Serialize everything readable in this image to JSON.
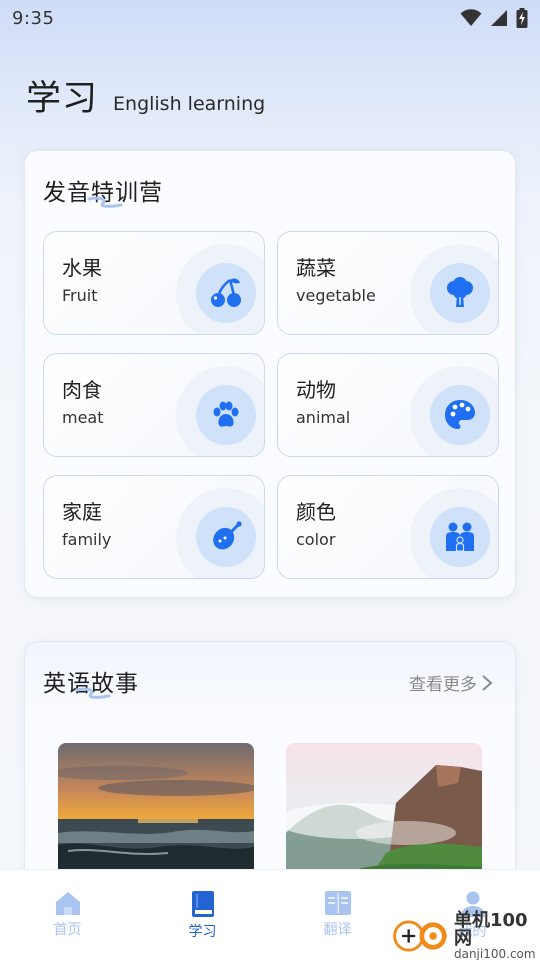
{
  "status_bar": {
    "time": "9:35"
  },
  "header": {
    "title": "学习",
    "subtitle": "English learning"
  },
  "pronunciation_camp": {
    "title": "发音特训营",
    "items": [
      {
        "zh": "水果",
        "en": "Fruit",
        "icon": "cherries-icon"
      },
      {
        "zh": "蔬菜",
        "en": "vegetable",
        "icon": "broccoli-icon"
      },
      {
        "zh": "肉食",
        "en": "meat",
        "icon": "paw-icon"
      },
      {
        "zh": "动物",
        "en": "animal",
        "icon": "palette-icon"
      },
      {
        "zh": "家庭",
        "en": "family",
        "icon": "drumstick-icon"
      },
      {
        "zh": "颜色",
        "en": "color",
        "icon": "people-icon"
      }
    ]
  },
  "stories": {
    "title": "英语故事",
    "more_label": "查看更多",
    "thumbnails": [
      "sunset-sea-image",
      "misty-cliff-image"
    ]
  },
  "bottom_nav": {
    "items": [
      {
        "label": "首页",
        "icon": "home-icon",
        "active": false
      },
      {
        "label": "学习",
        "icon": "book-icon",
        "active": true
      },
      {
        "label": "翻译",
        "icon": "translate-book-icon",
        "active": false
      },
      {
        "label": "我的",
        "icon": "user-icon",
        "active": false
      }
    ]
  },
  "watermark": {
    "name": "单机100网",
    "url": "danji100.com"
  },
  "colors": {
    "accent": "#2364d2",
    "icon_blue": "#1f6ff0",
    "icon_bg": "#cfe2fa",
    "nav_inactive": "#a9c4f0"
  }
}
